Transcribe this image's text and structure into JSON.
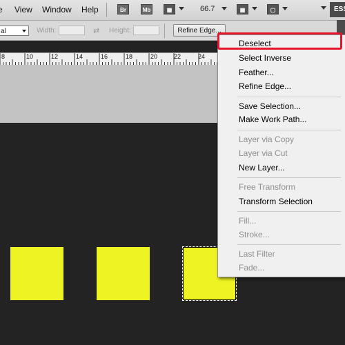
{
  "menubar": {
    "items": [
      "View",
      "Window",
      "Help"
    ],
    "bridge_icon": "Br",
    "minibridge_icon": "Mb",
    "zoom": "66.7",
    "workspace": "ESS"
  },
  "options": {
    "style_value": "al",
    "width_label": "Width:",
    "height_label": "Height:",
    "refine_button": "Refine Edge..."
  },
  "ruler": {
    "ticks": [
      "8",
      "10",
      "12",
      "14",
      "16",
      "18",
      "20",
      "22",
      "24"
    ]
  },
  "context_menu": {
    "items": [
      {
        "label": "Deselect",
        "enabled": true
      },
      {
        "label": "Select Inverse",
        "enabled": true
      },
      {
        "label": "Feather...",
        "enabled": true
      },
      {
        "label": "Refine Edge...",
        "enabled": true
      },
      {
        "label": "Save Selection...",
        "enabled": true
      },
      {
        "label": "Make Work Path...",
        "enabled": true
      },
      {
        "label": "Layer via Copy",
        "enabled": false
      },
      {
        "label": "Layer via Cut",
        "enabled": false
      },
      {
        "label": "New Layer...",
        "enabled": true
      },
      {
        "label": "Free Transform",
        "enabled": false
      },
      {
        "label": "Transform Selection",
        "enabled": true
      },
      {
        "label": "Fill...",
        "enabled": false
      },
      {
        "label": "Stroke...",
        "enabled": false
      },
      {
        "label": "Last Filter",
        "enabled": false
      },
      {
        "label": "Fade...",
        "enabled": false
      }
    ]
  },
  "colors": {
    "square_fill": "#eef322",
    "canvas_bg": "#232323",
    "highlight": "#e5142c"
  }
}
